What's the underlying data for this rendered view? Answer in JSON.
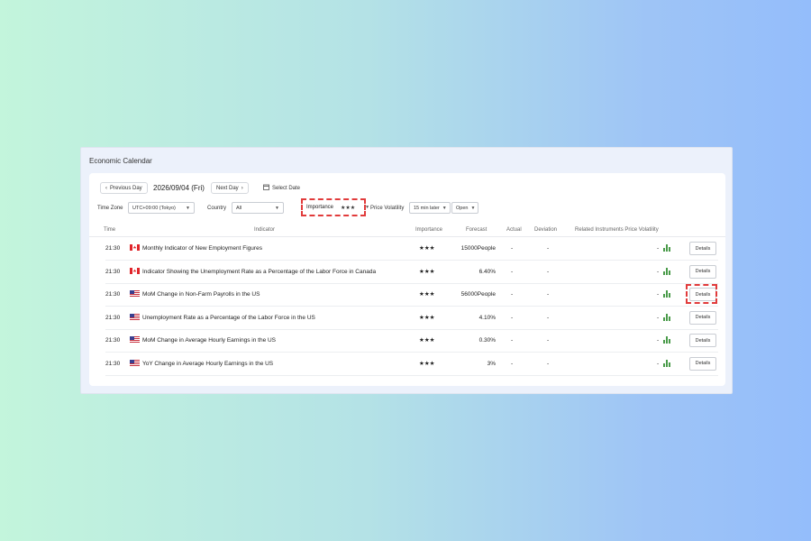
{
  "panel": {
    "title": "Economic Calendar"
  },
  "nav": {
    "prev_label": "Previous Day",
    "date": "2026/09/04 (Fri)",
    "next_label": "Next Day",
    "select_date_label": "Select Date"
  },
  "filters": {
    "timezone_label": "Time Zone",
    "timezone_value": "UTC+09:00 (Tokyo)",
    "country_label": "Country",
    "country_value": "All",
    "importance_label": "Importance",
    "importance_value": "★★★",
    "volatility_label": "Price Volatility",
    "volatility_window": "15 min later",
    "volatility_price": "Open"
  },
  "table": {
    "headers": {
      "time": "Time",
      "indicator": "Indicator",
      "importance": "Importance",
      "forecast": "Forecast",
      "actual": "Actual",
      "deviation": "Deviation",
      "related": "Related Instruments Price Volatility"
    },
    "rows": [
      {
        "time": "21:30",
        "country": "CA",
        "indicator": "Monthly Indicator of New Employment Figures",
        "importance": "★★★",
        "forecast": "15000People",
        "actual": "-",
        "deviation": "-",
        "volatility": "-",
        "details": "Details"
      },
      {
        "time": "21:30",
        "country": "CA",
        "indicator": "Indicator Showing the Unemployment Rate as a Percentage of the Labor Force in Canada",
        "importance": "★★★",
        "forecast": "6.40%",
        "actual": "-",
        "deviation": "-",
        "volatility": "-",
        "details": "Details"
      },
      {
        "time": "21:30",
        "country": "US",
        "indicator": "MoM Change in Non-Farm Payrolls in the US",
        "importance": "★★★",
        "forecast": "56000People",
        "actual": "-",
        "deviation": "-",
        "volatility": "-",
        "details": "Details"
      },
      {
        "time": "21:30",
        "country": "US",
        "indicator": "Unemployment Rate as a Percentage of the Labor Force in the US",
        "importance": "★★★",
        "forecast": "4.10%",
        "actual": "-",
        "deviation": "-",
        "volatility": "-",
        "details": "Details"
      },
      {
        "time": "21:30",
        "country": "US",
        "indicator": "MoM Change in Average Hourly Earnings in the US",
        "importance": "★★★",
        "forecast": "0.30%",
        "actual": "-",
        "deviation": "-",
        "volatility": "-",
        "details": "Details"
      },
      {
        "time": "21:30",
        "country": "US",
        "indicator": "YoY Change in Average Hourly Earnings in the US",
        "importance": "★★★",
        "forecast": "3%",
        "actual": "-",
        "deviation": "-",
        "volatility": "-",
        "details": "Details"
      }
    ]
  },
  "colors": {
    "accent_star": "#f07a2c",
    "highlight": "#e13b3b",
    "chart_green": "#4a9b4a"
  }
}
